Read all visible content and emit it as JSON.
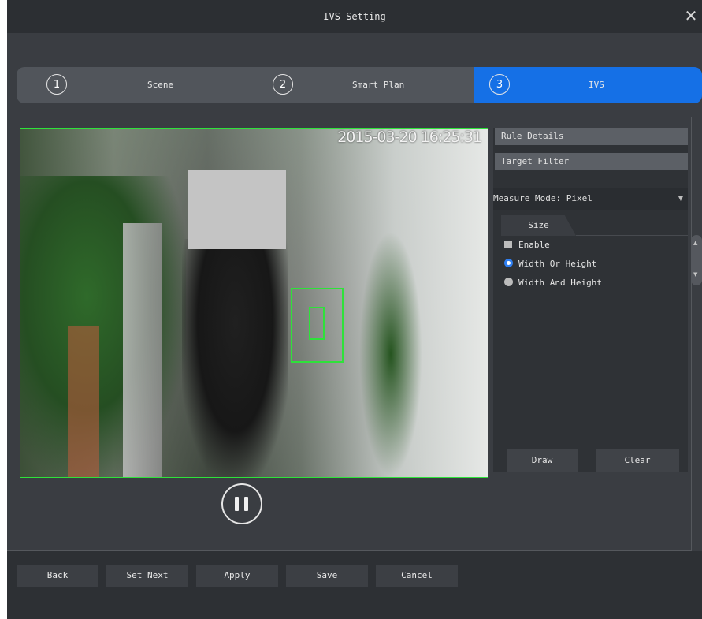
{
  "window": {
    "title": "IVS Setting",
    "close_icon": "close-icon"
  },
  "steps": [
    {
      "number": "1",
      "label": "Scene",
      "active": false
    },
    {
      "number": "2",
      "label": "Smart Plan",
      "active": false
    },
    {
      "number": "3",
      "label": "IVS",
      "active": true
    }
  ],
  "video": {
    "timestamp": "2015-03-20 16:25:31"
  },
  "panel": {
    "rule_details": "Rule Details",
    "target_filter": "Target Filter",
    "measure_mode": "Measure Mode: Pixel",
    "tab_size": "Size",
    "enable_label": "Enable",
    "enable_checked": false,
    "option_width_or_height": "Width Or Height",
    "option_width_and_height": "Width And Height",
    "selected_option": "Width Or Height",
    "draw_button": "Draw",
    "clear_button": "Clear"
  },
  "footer": {
    "back": "Back",
    "set_next": "Set Next",
    "apply": "Apply",
    "save": "Save",
    "cancel": "Cancel"
  },
  "colors": {
    "active_step": "#1570e6",
    "roi_border": "#2ee23a",
    "radio_selected": "#2f7ff2"
  }
}
